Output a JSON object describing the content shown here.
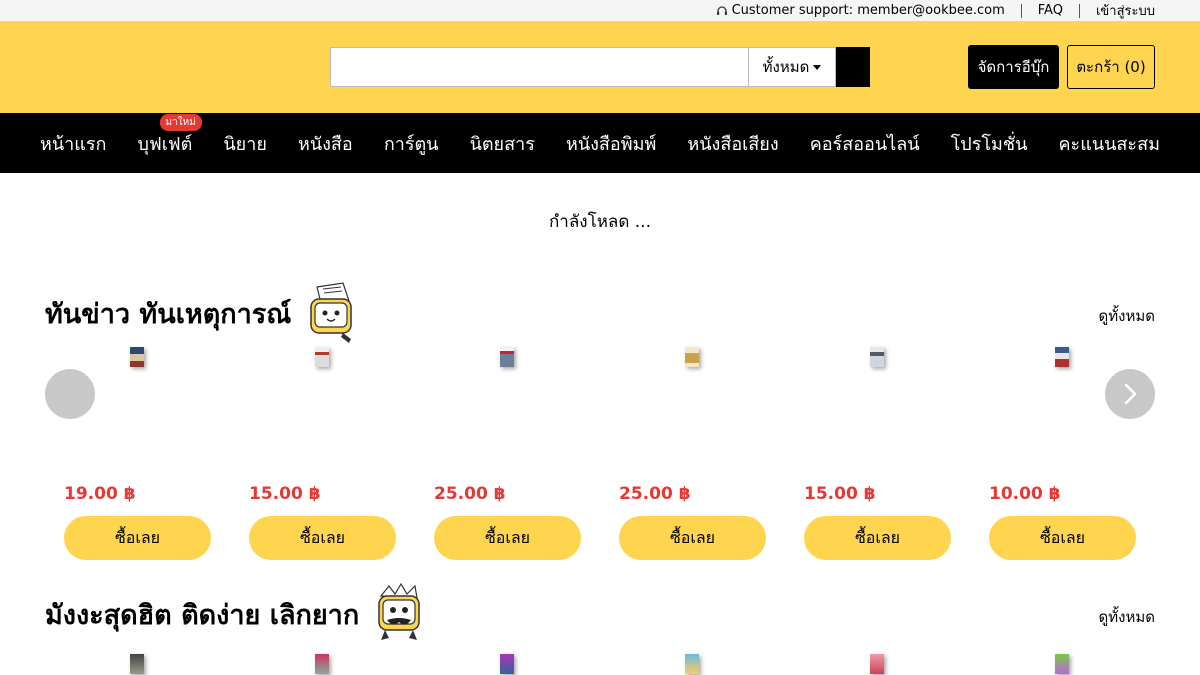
{
  "topbar": {
    "support": "Customer support: member@ookbee.com",
    "faq": "FAQ",
    "login": "เข้าสู่ระบบ"
  },
  "header": {
    "search_placeholder": "",
    "search_scope": "ทั้งหมด",
    "manage_label": "จัดการอีบุ๊ก",
    "cart_label": "ตะกร้า (0)"
  },
  "nav": {
    "items": [
      {
        "label": "หน้าแรก"
      },
      {
        "label": "บุฟเฟต์",
        "badge": "มาใหม่"
      },
      {
        "label": "นิยาย"
      },
      {
        "label": "หนังสือ"
      },
      {
        "label": "การ์ตูน"
      },
      {
        "label": "นิตยสาร"
      },
      {
        "label": "หนังสือพิมพ์"
      },
      {
        "label": "หนังสือเสียง"
      },
      {
        "label": "คอร์สออนไลน์"
      },
      {
        "label": "โปรโมชั่น"
      },
      {
        "label": "คะแนนสะสม"
      }
    ]
  },
  "loading": "กำลังโหลด ...",
  "section1": {
    "title": "ทันข่าว ทันเหตุการณ์",
    "view_all": "ดูทั้งหมด",
    "products": [
      {
        "price": "19.00 ฿",
        "buy": "ซื้อเลย"
      },
      {
        "price": "15.00 ฿",
        "buy": "ซื้อเลย"
      },
      {
        "price": "25.00 ฿",
        "buy": "ซื้อเลย"
      },
      {
        "price": "25.00 ฿",
        "buy": "ซื้อเลย"
      },
      {
        "price": "15.00 ฿",
        "buy": "ซื้อเลย"
      },
      {
        "price": "10.00 ฿",
        "buy": "ซื้อเลย"
      }
    ]
  },
  "section2": {
    "title": "มังงะสุดฮิต ติดง่าย เลิกยาก",
    "view_all": "ดูทั้งหมด"
  },
  "colors": {
    "brand_yellow": "#ffd54f",
    "price_red": "#e53935",
    "nav_black": "#000000"
  }
}
